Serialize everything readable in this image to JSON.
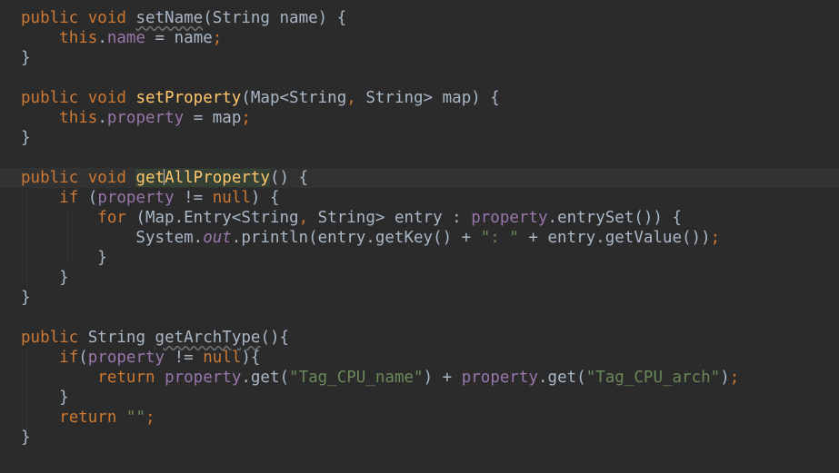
{
  "editor": {
    "lines": [
      [
        {
          "t": "public ",
          "c": "kw"
        },
        {
          "t": "void ",
          "c": "kw"
        },
        {
          "t": "setName",
          "c": "warn"
        },
        {
          "t": "(String name) {"
        }
      ],
      [
        {
          "t": "    "
        },
        {
          "t": "this",
          "c": "kw"
        },
        {
          "t": "."
        },
        {
          "t": "name",
          "c": "fld"
        },
        {
          "t": " = name"
        },
        {
          "t": ";",
          "c": "kw"
        }
      ],
      [
        {
          "t": "}"
        }
      ],
      [],
      [
        {
          "t": "public ",
          "c": "kw"
        },
        {
          "t": "void ",
          "c": "kw"
        },
        {
          "t": "setProperty",
          "c": "fn"
        },
        {
          "t": "(Map<String"
        },
        {
          "t": ", ",
          "c": "kw"
        },
        {
          "t": "String> map) {"
        }
      ],
      [
        {
          "t": "    "
        },
        {
          "t": "this",
          "c": "kw"
        },
        {
          "t": "."
        },
        {
          "t": "property",
          "c": "fld"
        },
        {
          "t": " = map"
        },
        {
          "t": ";",
          "c": "kw"
        }
      ],
      [
        {
          "t": "}"
        }
      ],
      [],
      [
        {
          "t": "public ",
          "c": "kw"
        },
        {
          "t": "void ",
          "c": "kw"
        },
        {
          "t": "get",
          "c": "fn caret-word"
        },
        {
          "t": "|",
          "c": "caret"
        },
        {
          "t": "AllProperty",
          "c": "fn caret-word"
        },
        {
          "t": "() {"
        }
      ],
      [
        {
          "t": "    "
        },
        {
          "t": "if ",
          "c": "kw"
        },
        {
          "t": "("
        },
        {
          "t": "property",
          "c": "fld"
        },
        {
          "t": " != "
        },
        {
          "t": "null",
          "c": "kw"
        },
        {
          "t": ") {"
        }
      ],
      [
        {
          "t": "        "
        },
        {
          "t": "for ",
          "c": "kw"
        },
        {
          "t": "(Map.Entry<String"
        },
        {
          "t": ", ",
          "c": "kw"
        },
        {
          "t": "String> entry : "
        },
        {
          "t": "property",
          "c": "fld"
        },
        {
          "t": ".entrySet()) {"
        }
      ],
      [
        {
          "t": "            System."
        },
        {
          "t": "out",
          "c": "ital"
        },
        {
          "t": ".println(entry.getKey() + "
        },
        {
          "t": "\": \"",
          "c": "str"
        },
        {
          "t": " + entry.getValue())"
        },
        {
          "t": ";",
          "c": "kw"
        }
      ],
      [
        {
          "t": "        }"
        }
      ],
      [
        {
          "t": "    }"
        }
      ],
      [
        {
          "t": "}"
        }
      ],
      [],
      [
        {
          "t": "public ",
          "c": "kw"
        },
        {
          "t": "String "
        },
        {
          "t": "getArchType",
          "c": "warn"
        },
        {
          "t": "(){"
        }
      ],
      [
        {
          "t": "    "
        },
        {
          "t": "if",
          "c": "kw"
        },
        {
          "t": "("
        },
        {
          "t": "property",
          "c": "fld"
        },
        {
          "t": " != "
        },
        {
          "t": "null",
          "c": "kw"
        },
        {
          "t": "){"
        }
      ],
      [
        {
          "t": "        "
        },
        {
          "t": "return ",
          "c": "kw"
        },
        {
          "t": "property",
          "c": "fld"
        },
        {
          "t": ".get("
        },
        {
          "t": "\"Tag_CPU_name\"",
          "c": "str"
        },
        {
          "t": ") + "
        },
        {
          "t": "property",
          "c": "fld"
        },
        {
          "t": ".get("
        },
        {
          "t": "\"Tag_CPU_arch\"",
          "c": "str"
        },
        {
          "t": ")"
        },
        {
          "t": ";",
          "c": "kw"
        }
      ],
      [
        {
          "t": "    }"
        }
      ],
      [
        {
          "t": "    "
        },
        {
          "t": "return ",
          "c": "kw"
        },
        {
          "t": "\"\"",
          "c": "str"
        },
        {
          "t": ";",
          "c": "kw"
        }
      ],
      [
        {
          "t": "}"
        }
      ]
    ],
    "current_line": 9,
    "colors": {
      "background": "#2b2b2b",
      "current_line": "#323232",
      "default_text": "#a9b7c6",
      "keyword": "#cc7832",
      "field": "#9876aa",
      "string": "#6a8759",
      "method_declaration": "#ffc66d",
      "indent_guide": "#3b3b3b"
    }
  }
}
